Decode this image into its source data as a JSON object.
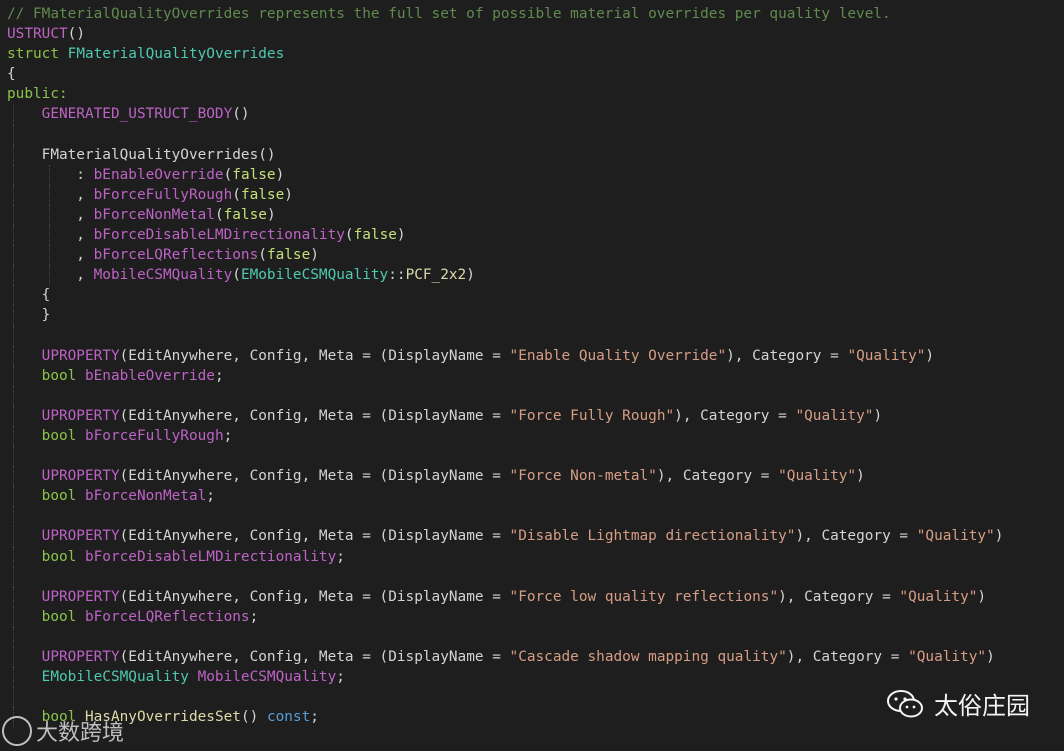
{
  "code": {
    "lines": [
      [
        {
          "t": "// FMaterialQualityOverrides represents the full set of possible material overrides per quality level.",
          "c": "c-comment2"
        }
      ],
      [
        {
          "t": "USTRUCT",
          "c": "c-macro"
        },
        {
          "t": "()",
          "c": "c-plain"
        }
      ],
      [
        {
          "t": "struct ",
          "c": "c-green"
        },
        {
          "t": "FMaterialQualityOverrides",
          "c": "c-type"
        }
      ],
      [
        {
          "t": "{",
          "c": "c-plain"
        }
      ],
      [
        {
          "t": "public:",
          "c": "c-green"
        }
      ],
      [
        {
          "t": "    ",
          "c": "c-plain"
        },
        {
          "t": "GENERATED_USTRUCT_BODY",
          "c": "c-macro"
        },
        {
          "t": "()",
          "c": "c-plain"
        }
      ],
      [
        {
          "t": "",
          "c": "c-plain"
        }
      ],
      [
        {
          "t": "    FMaterialQualityOverrides()",
          "c": "c-plain"
        }
      ],
      [
        {
          "t": "        : ",
          "c": "c-plain"
        },
        {
          "t": "bEnableOverride",
          "c": "c-macro"
        },
        {
          "t": "(",
          "c": "c-plain"
        },
        {
          "t": "false",
          "c": "c-bool"
        },
        {
          "t": ")",
          "c": "c-plain"
        }
      ],
      [
        {
          "t": "        , ",
          "c": "c-plain"
        },
        {
          "t": "bForceFullyRough",
          "c": "c-macro"
        },
        {
          "t": "(",
          "c": "c-plain"
        },
        {
          "t": "false",
          "c": "c-bool"
        },
        {
          "t": ")",
          "c": "c-plain"
        }
      ],
      [
        {
          "t": "        , ",
          "c": "c-plain"
        },
        {
          "t": "bForceNonMetal",
          "c": "c-macro"
        },
        {
          "t": "(",
          "c": "c-plain"
        },
        {
          "t": "false",
          "c": "c-bool"
        },
        {
          "t": ")",
          "c": "c-plain"
        }
      ],
      [
        {
          "t": "        , ",
          "c": "c-plain"
        },
        {
          "t": "bForceDisableLMDirectionality",
          "c": "c-macro"
        },
        {
          "t": "(",
          "c": "c-plain"
        },
        {
          "t": "false",
          "c": "c-bool"
        },
        {
          "t": ")",
          "c": "c-plain"
        }
      ],
      [
        {
          "t": "        , ",
          "c": "c-plain"
        },
        {
          "t": "bForceLQReflections",
          "c": "c-macro"
        },
        {
          "t": "(",
          "c": "c-plain"
        },
        {
          "t": "false",
          "c": "c-bool"
        },
        {
          "t": ")",
          "c": "c-plain"
        }
      ],
      [
        {
          "t": "        , ",
          "c": "c-plain"
        },
        {
          "t": "MobileCSMQuality",
          "c": "c-macro"
        },
        {
          "t": "(",
          "c": "c-plain"
        },
        {
          "t": "EMobileCSMQuality",
          "c": "c-type"
        },
        {
          "t": "::",
          "c": "c-plain"
        },
        {
          "t": "PCF_2x2",
          "c": "c-fn"
        },
        {
          "t": ")",
          "c": "c-plain"
        }
      ],
      [
        {
          "t": "    {",
          "c": "c-plain"
        }
      ],
      [
        {
          "t": "    }",
          "c": "c-plain"
        }
      ],
      [
        {
          "t": "",
          "c": "c-plain"
        }
      ],
      [
        {
          "t": "    ",
          "c": "c-plain"
        },
        {
          "t": "UPROPERTY",
          "c": "c-macro"
        },
        {
          "t": "(EditAnywhere, Config, Meta = (DisplayName = ",
          "c": "c-plain"
        },
        {
          "t": "\"Enable Quality Override\"",
          "c": "c-str"
        },
        {
          "t": "), Category = ",
          "c": "c-plain"
        },
        {
          "t": "\"Quality\"",
          "c": "c-str"
        },
        {
          "t": ")",
          "c": "c-plain"
        }
      ],
      [
        {
          "t": "    ",
          "c": "c-plain"
        },
        {
          "t": "bool ",
          "c": "c-green"
        },
        {
          "t": "bEnableOverride",
          "c": "c-macro"
        },
        {
          "t": ";",
          "c": "c-plain"
        }
      ],
      [
        {
          "t": "",
          "c": "c-plain"
        }
      ],
      [
        {
          "t": "    ",
          "c": "c-plain"
        },
        {
          "t": "UPROPERTY",
          "c": "c-macro"
        },
        {
          "t": "(EditAnywhere, Config, Meta = (DisplayName = ",
          "c": "c-plain"
        },
        {
          "t": "\"Force Fully Rough\"",
          "c": "c-str"
        },
        {
          "t": "), Category = ",
          "c": "c-plain"
        },
        {
          "t": "\"Quality\"",
          "c": "c-str"
        },
        {
          "t": ")",
          "c": "c-plain"
        }
      ],
      [
        {
          "t": "    ",
          "c": "c-plain"
        },
        {
          "t": "bool ",
          "c": "c-green"
        },
        {
          "t": "bForceFullyRough",
          "c": "c-macro"
        },
        {
          "t": ";",
          "c": "c-plain"
        }
      ],
      [
        {
          "t": "",
          "c": "c-plain"
        }
      ],
      [
        {
          "t": "    ",
          "c": "c-plain"
        },
        {
          "t": "UPROPERTY",
          "c": "c-macro"
        },
        {
          "t": "(EditAnywhere, Config, Meta = (DisplayName = ",
          "c": "c-plain"
        },
        {
          "t": "\"Force Non-metal\"",
          "c": "c-str"
        },
        {
          "t": "), Category = ",
          "c": "c-plain"
        },
        {
          "t": "\"Quality\"",
          "c": "c-str"
        },
        {
          "t": ")",
          "c": "c-plain"
        }
      ],
      [
        {
          "t": "    ",
          "c": "c-plain"
        },
        {
          "t": "bool ",
          "c": "c-green"
        },
        {
          "t": "bForceNonMetal",
          "c": "c-macro"
        },
        {
          "t": ";",
          "c": "c-plain"
        }
      ],
      [
        {
          "t": "",
          "c": "c-plain"
        }
      ],
      [
        {
          "t": "    ",
          "c": "c-plain"
        },
        {
          "t": "UPROPERTY",
          "c": "c-macro"
        },
        {
          "t": "(EditAnywhere, Config, Meta = (DisplayName = ",
          "c": "c-plain"
        },
        {
          "t": "\"Disable Lightmap directionality\"",
          "c": "c-str"
        },
        {
          "t": "), Category = ",
          "c": "c-plain"
        },
        {
          "t": "\"Quality\"",
          "c": "c-str"
        },
        {
          "t": ")",
          "c": "c-plain"
        }
      ],
      [
        {
          "t": "    ",
          "c": "c-plain"
        },
        {
          "t": "bool ",
          "c": "c-green"
        },
        {
          "t": "bForceDisableLMDirectionality",
          "c": "c-macro"
        },
        {
          "t": ";",
          "c": "c-plain"
        }
      ],
      [
        {
          "t": "",
          "c": "c-plain"
        }
      ],
      [
        {
          "t": "    ",
          "c": "c-plain"
        },
        {
          "t": "UPROPERTY",
          "c": "c-macro"
        },
        {
          "t": "(EditAnywhere, Config, Meta = (DisplayName = ",
          "c": "c-plain"
        },
        {
          "t": "\"Force low quality reflections\"",
          "c": "c-str"
        },
        {
          "t": "), Category = ",
          "c": "c-plain"
        },
        {
          "t": "\"Quality\"",
          "c": "c-str"
        },
        {
          "t": ")",
          "c": "c-plain"
        }
      ],
      [
        {
          "t": "    ",
          "c": "c-plain"
        },
        {
          "t": "bool ",
          "c": "c-green"
        },
        {
          "t": "bForceLQReflections",
          "c": "c-macro"
        },
        {
          "t": ";",
          "c": "c-plain"
        }
      ],
      [
        {
          "t": "",
          "c": "c-plain"
        }
      ],
      [
        {
          "t": "    ",
          "c": "c-plain"
        },
        {
          "t": "UPROPERTY",
          "c": "c-macro"
        },
        {
          "t": "(EditAnywhere, Config, Meta = (DisplayName = ",
          "c": "c-plain"
        },
        {
          "t": "\"Cascade shadow mapping quality\"",
          "c": "c-str"
        },
        {
          "t": "), Category = ",
          "c": "c-plain"
        },
        {
          "t": "\"Quality\"",
          "c": "c-str"
        },
        {
          "t": ")",
          "c": "c-plain"
        }
      ],
      [
        {
          "t": "    ",
          "c": "c-plain"
        },
        {
          "t": "EMobileCSMQuality ",
          "c": "c-type"
        },
        {
          "t": "MobileCSMQuality",
          "c": "c-macro"
        },
        {
          "t": ";",
          "c": "c-plain"
        }
      ],
      [
        {
          "t": "",
          "c": "c-plain"
        }
      ],
      [
        {
          "t": "    ",
          "c": "c-plain"
        },
        {
          "t": "bool ",
          "c": "c-green"
        },
        {
          "t": "HasAnyOverridesSet",
          "c": "c-fn"
        },
        {
          "t": "() ",
          "c": "c-plain"
        },
        {
          "t": "const",
          "c": "c-kw"
        },
        {
          "t": ";",
          "c": "c-plain"
        }
      ]
    ],
    "guide_depths": [
      0,
      0,
      0,
      0,
      0,
      1,
      1,
      1,
      2,
      2,
      2,
      2,
      2,
      2,
      1,
      1,
      1,
      1,
      1,
      1,
      1,
      1,
      1,
      1,
      1,
      1,
      1,
      1,
      1,
      1,
      1,
      1,
      1,
      1,
      1,
      1
    ]
  },
  "watermark_left": {
    "text": "大数跨境"
  },
  "watermark_right": {
    "text": "太俗庄园"
  }
}
